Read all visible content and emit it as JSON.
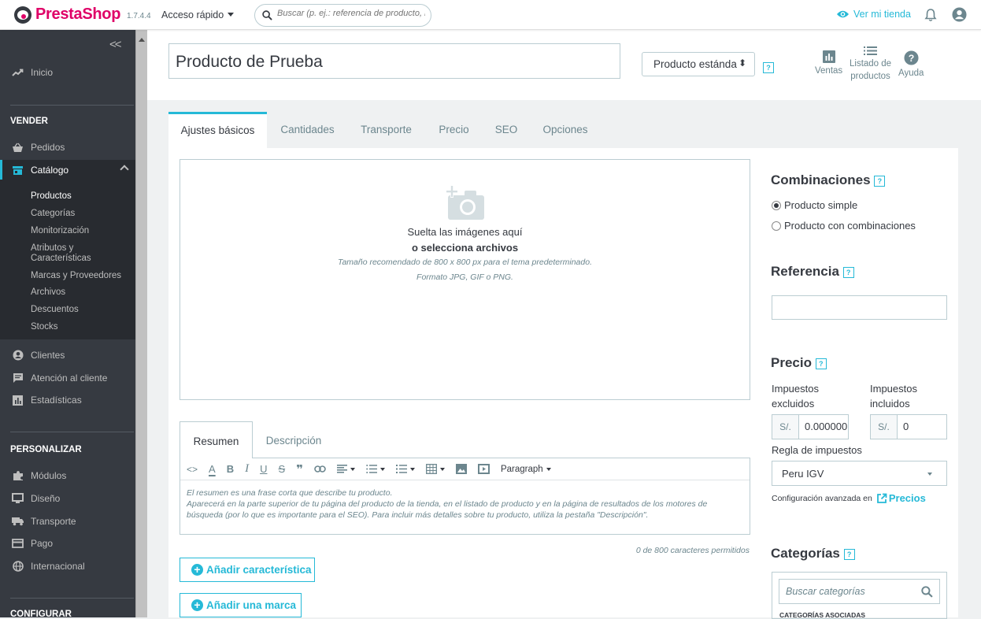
{
  "topbar": {
    "brand": "PrestaShop",
    "version": "1.7.4.4",
    "quick_access": "Acceso rápido",
    "search_placeholder": "Buscar (p. ej.: referencia de producto, no",
    "view_shop": "Ver mi tienda"
  },
  "sidebar": {
    "home": "Inicio",
    "sell_section": "VENDER",
    "orders": "Pedidos",
    "catalog": "Catálogo",
    "catalog_sub": [
      "Productos",
      "Categorías",
      "Monitorización",
      "Atributos y\nCaracterísticas",
      "Marcas y Proveedores",
      "Archivos",
      "Descuentos",
      "Stocks"
    ],
    "customers": "Clientes",
    "customer_service": "Atención al cliente",
    "stats": "Estadísticas",
    "customize_section": "PERSONALIZAR",
    "modules": "Módulos",
    "design": "Diseño",
    "shipping": "Transporte",
    "payment": "Pago",
    "international": "Internacional",
    "configure_section": "CONFIGURAR"
  },
  "header": {
    "product_name": "Producto de Prueba",
    "product_type": "Producto estánda",
    "help": "?",
    "sales": "Ventas",
    "product_list_1": "Listado de",
    "product_list_2": "productos",
    "help_label": "Ayuda"
  },
  "tabs": [
    "Ajustes básicos",
    "Cantidades",
    "Transporte",
    "Precio",
    "SEO",
    "Opciones"
  ],
  "dropzone": {
    "line1": "Suelta las imágenes aquí",
    "line2": "o selecciona archivos",
    "line3": "Tamaño recomendado de 800 x 800 px para el tema predeterminado.",
    "line4": "Formato JPG, GIF o PNG."
  },
  "desc_tabs": [
    "Resumen",
    "Descripción"
  ],
  "editor": {
    "paragraph": "Paragraph",
    "text1": "El resumen es una frase corta que describe tu producto.",
    "text2": "Aparecerá en la parte superior de tu página del producto de la tienda, en el listado de producto y en la página de resultados de los motores de búsqueda (por lo que es importante para el SEO). Para incluir más detalles sobre tu producto, utiliza la pestaña \"Descripción\".",
    "counter": "0 de 800 caracteres permitidos"
  },
  "buttons": {
    "add_feature": "Añadir característica",
    "add_brand": "Añadir una marca"
  },
  "right": {
    "combinations_title": "Combinaciones",
    "simple_product": "Producto simple",
    "with_combinations": "Producto con combinaciones",
    "reference_title": "Referencia",
    "reference_value": "",
    "price_title": "Precio",
    "tax_excl_1": "Impuestos",
    "tax_excl_2": "excluidos",
    "tax_incl_1": "Impuestos",
    "tax_incl_2": "incluidos",
    "currency": "S/.",
    "price_excl": "0.000000",
    "price_incl": "0",
    "tax_rule_label": "Regla de impuestos",
    "tax_rule": "Peru IGV",
    "advanced": "Configuración avanzada en",
    "prices_link": "Precios",
    "categories_title": "Categorías",
    "cat_search": "Buscar categorías",
    "associated": "CATEGORÍAS ASOCIADAS"
  },
  "colors": {
    "accent": "#25b9d7",
    "brand": "#df0067",
    "sidebar": "#363a41"
  }
}
